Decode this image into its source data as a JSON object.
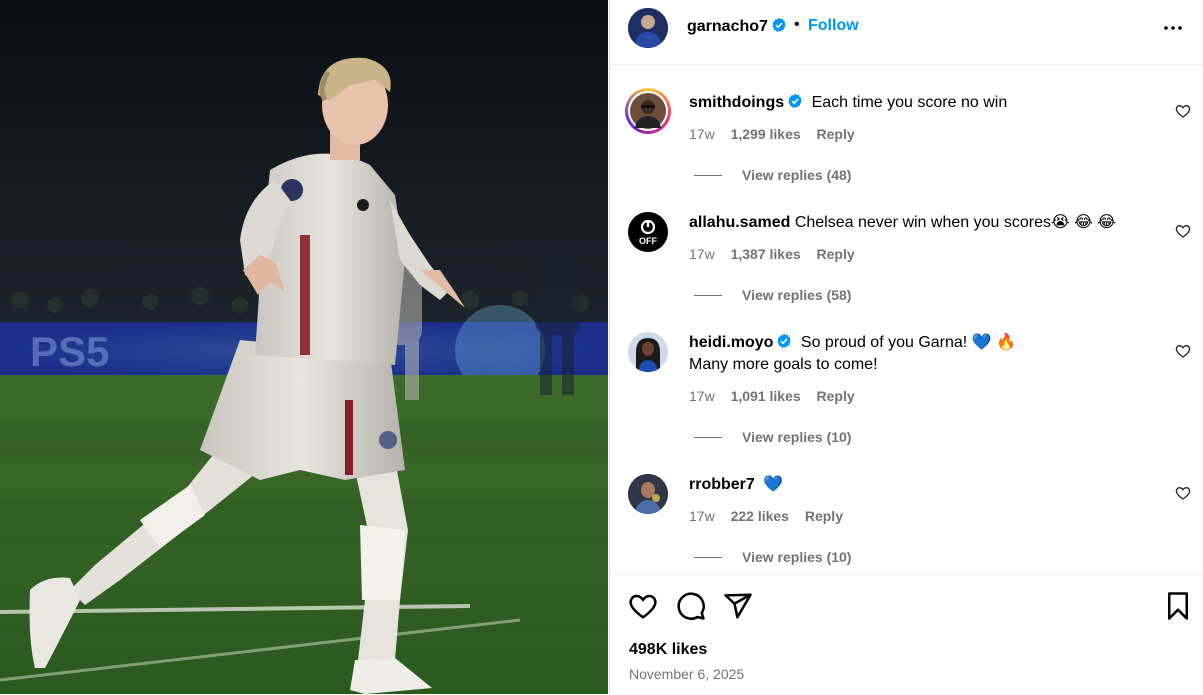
{
  "post": {
    "username": "garnacho7",
    "follow_label": "Follow",
    "separator": "•",
    "likes_total": "498K likes",
    "date": "November 6, 2025"
  },
  "comments": [
    {
      "username": "smithdoings",
      "verified": true,
      "text": "Each time you score no win",
      "text2": "",
      "time": "17w",
      "likes": "1,299 likes",
      "reply_label": "Reply",
      "view_replies": "View replies (48)"
    },
    {
      "username": "allahu.samed",
      "verified": false,
      "text": "Chelsea never win when you scores😭 😂 😂",
      "text2": "",
      "time": "17w",
      "likes": "1,387 likes",
      "reply_label": "Reply",
      "view_replies": "View replies (58)"
    },
    {
      "username": "heidi.moyo",
      "verified": true,
      "text": "So proud of you Garna! 💙 🔥",
      "text2": "Many more goals to come!",
      "time": "17w",
      "likes": "1,091 likes",
      "reply_label": "Reply",
      "view_replies": "View replies (10)"
    },
    {
      "username": "rrobber7",
      "verified": false,
      "text": "💙",
      "text2": "",
      "time": "17w",
      "likes": "222 likes",
      "reply_label": "Reply",
      "view_replies": "View replies (10)"
    }
  ],
  "avatar_badge": "OFF",
  "photo_text": {
    "sponsor": "PS5"
  },
  "icons": {
    "more": "more-horizontal-icon",
    "like": "heart-icon",
    "comment": "comment-icon",
    "share": "share-icon",
    "save": "bookmark-icon",
    "verified": "verified-badge-icon"
  },
  "colors": {
    "link": "#0095f6",
    "meta": "#737373",
    "verified": "#0095f6"
  }
}
